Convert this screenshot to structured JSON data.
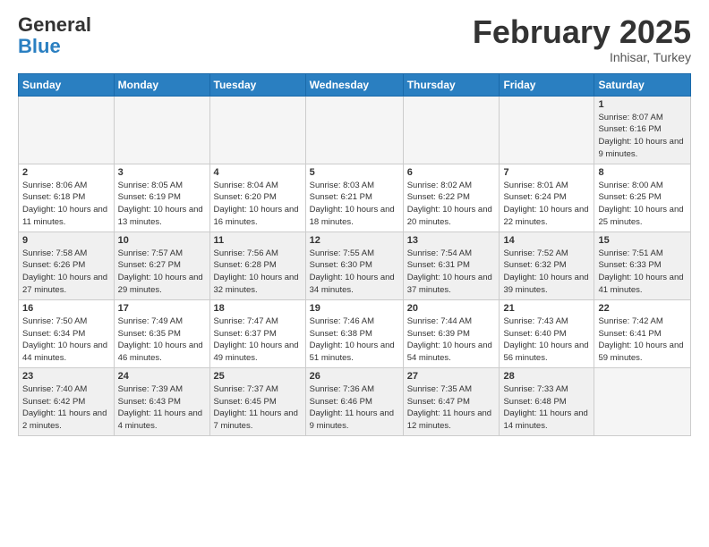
{
  "header": {
    "logo_general": "General",
    "logo_blue": "Blue",
    "month_title": "February 2025",
    "location": "Inhisar, Turkey"
  },
  "days_of_week": [
    "Sunday",
    "Monday",
    "Tuesday",
    "Wednesday",
    "Thursday",
    "Friday",
    "Saturday"
  ],
  "weeks": [
    [
      {
        "day": "",
        "empty": true
      },
      {
        "day": "",
        "empty": true
      },
      {
        "day": "",
        "empty": true
      },
      {
        "day": "",
        "empty": true
      },
      {
        "day": "",
        "empty": true
      },
      {
        "day": "",
        "empty": true
      },
      {
        "day": "1",
        "sunrise": "8:07 AM",
        "sunset": "6:16 PM",
        "daylight": "10 hours and 9 minutes."
      }
    ],
    [
      {
        "day": "2",
        "sunrise": "8:06 AM",
        "sunset": "6:18 PM",
        "daylight": "10 hours and 11 minutes."
      },
      {
        "day": "3",
        "sunrise": "8:05 AM",
        "sunset": "6:19 PM",
        "daylight": "10 hours and 13 minutes."
      },
      {
        "day": "4",
        "sunrise": "8:04 AM",
        "sunset": "6:20 PM",
        "daylight": "10 hours and 16 minutes."
      },
      {
        "day": "5",
        "sunrise": "8:03 AM",
        "sunset": "6:21 PM",
        "daylight": "10 hours and 18 minutes."
      },
      {
        "day": "6",
        "sunrise": "8:02 AM",
        "sunset": "6:22 PM",
        "daylight": "10 hours and 20 minutes."
      },
      {
        "day": "7",
        "sunrise": "8:01 AM",
        "sunset": "6:24 PM",
        "daylight": "10 hours and 22 minutes."
      },
      {
        "day": "8",
        "sunrise": "8:00 AM",
        "sunset": "6:25 PM",
        "daylight": "10 hours and 25 minutes."
      }
    ],
    [
      {
        "day": "9",
        "sunrise": "7:58 AM",
        "sunset": "6:26 PM",
        "daylight": "10 hours and 27 minutes."
      },
      {
        "day": "10",
        "sunrise": "7:57 AM",
        "sunset": "6:27 PM",
        "daylight": "10 hours and 29 minutes."
      },
      {
        "day": "11",
        "sunrise": "7:56 AM",
        "sunset": "6:28 PM",
        "daylight": "10 hours and 32 minutes."
      },
      {
        "day": "12",
        "sunrise": "7:55 AM",
        "sunset": "6:30 PM",
        "daylight": "10 hours and 34 minutes."
      },
      {
        "day": "13",
        "sunrise": "7:54 AM",
        "sunset": "6:31 PM",
        "daylight": "10 hours and 37 minutes."
      },
      {
        "day": "14",
        "sunrise": "7:52 AM",
        "sunset": "6:32 PM",
        "daylight": "10 hours and 39 minutes."
      },
      {
        "day": "15",
        "sunrise": "7:51 AM",
        "sunset": "6:33 PM",
        "daylight": "10 hours and 41 minutes."
      }
    ],
    [
      {
        "day": "16",
        "sunrise": "7:50 AM",
        "sunset": "6:34 PM",
        "daylight": "10 hours and 44 minutes."
      },
      {
        "day": "17",
        "sunrise": "7:49 AM",
        "sunset": "6:35 PM",
        "daylight": "10 hours and 46 minutes."
      },
      {
        "day": "18",
        "sunrise": "7:47 AM",
        "sunset": "6:37 PM",
        "daylight": "10 hours and 49 minutes."
      },
      {
        "day": "19",
        "sunrise": "7:46 AM",
        "sunset": "6:38 PM",
        "daylight": "10 hours and 51 minutes."
      },
      {
        "day": "20",
        "sunrise": "7:44 AM",
        "sunset": "6:39 PM",
        "daylight": "10 hours and 54 minutes."
      },
      {
        "day": "21",
        "sunrise": "7:43 AM",
        "sunset": "6:40 PM",
        "daylight": "10 hours and 56 minutes."
      },
      {
        "day": "22",
        "sunrise": "7:42 AM",
        "sunset": "6:41 PM",
        "daylight": "10 hours and 59 minutes."
      }
    ],
    [
      {
        "day": "23",
        "sunrise": "7:40 AM",
        "sunset": "6:42 PM",
        "daylight": "11 hours and 2 minutes."
      },
      {
        "day": "24",
        "sunrise": "7:39 AM",
        "sunset": "6:43 PM",
        "daylight": "11 hours and 4 minutes."
      },
      {
        "day": "25",
        "sunrise": "7:37 AM",
        "sunset": "6:45 PM",
        "daylight": "11 hours and 7 minutes."
      },
      {
        "day": "26",
        "sunrise": "7:36 AM",
        "sunset": "6:46 PM",
        "daylight": "11 hours and 9 minutes."
      },
      {
        "day": "27",
        "sunrise": "7:35 AM",
        "sunset": "6:47 PM",
        "daylight": "11 hours and 12 minutes."
      },
      {
        "day": "28",
        "sunrise": "7:33 AM",
        "sunset": "6:48 PM",
        "daylight": "11 hours and 14 minutes."
      },
      {
        "day": "",
        "empty": true
      }
    ]
  ]
}
